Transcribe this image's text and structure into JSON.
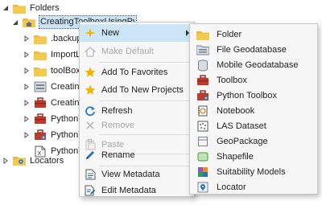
{
  "tree": {
    "folders_label": "Folders",
    "selected_label": "CreatingToolboxUsingPython",
    "children": [
      {
        "label": ".backups",
        "icon": "folder-icon"
      },
      {
        "label": "ImportLog",
        "icon": "folder-icon"
      },
      {
        "label": "toolBoxSc",
        "icon": "folder-icon"
      },
      {
        "label": "CreatingTo",
        "icon": "geodatabase-icon"
      },
      {
        "label": "CreatingTo",
        "icon": "toolbox-icon"
      },
      {
        "label": "PythonToo",
        "icon": "toolbox-icon"
      },
      {
        "label": "PythonToo",
        "icon": "python-toolbox-icon"
      },
      {
        "label": "PythonToo",
        "icon": "python-script-icon"
      }
    ],
    "locators_label": "Locators"
  },
  "context_menu": {
    "new": "New",
    "make_default": "Make Default",
    "add_to_favorites": "Add To Favorites",
    "add_to_new_projects": "Add To New Projects",
    "refresh": "Refresh",
    "remove": "Remove",
    "paste": "Paste",
    "rename": "Rename",
    "view_metadata": "View Metadata",
    "edit_metadata": "Edit Metadata"
  },
  "new_submenu": {
    "folder": "Folder",
    "file_geodatabase": "File Geodatabase",
    "mobile_geodatabase": "Mobile Geodatabase",
    "toolbox": "Toolbox",
    "python_toolbox": "Python Toolbox",
    "notebook": "Notebook",
    "las_dataset": "LAS Dataset",
    "geopackage": "GeoPackage",
    "shapefile": "Shapefile",
    "suitability_models": "Suitability Models",
    "locator": "Locator"
  },
  "colors": {
    "highlight": "#cde6f7",
    "folder": "#e8b84a",
    "star": "#f0b400",
    "toolbox": "#c0392b",
    "refresh": "#1e7bd0"
  }
}
